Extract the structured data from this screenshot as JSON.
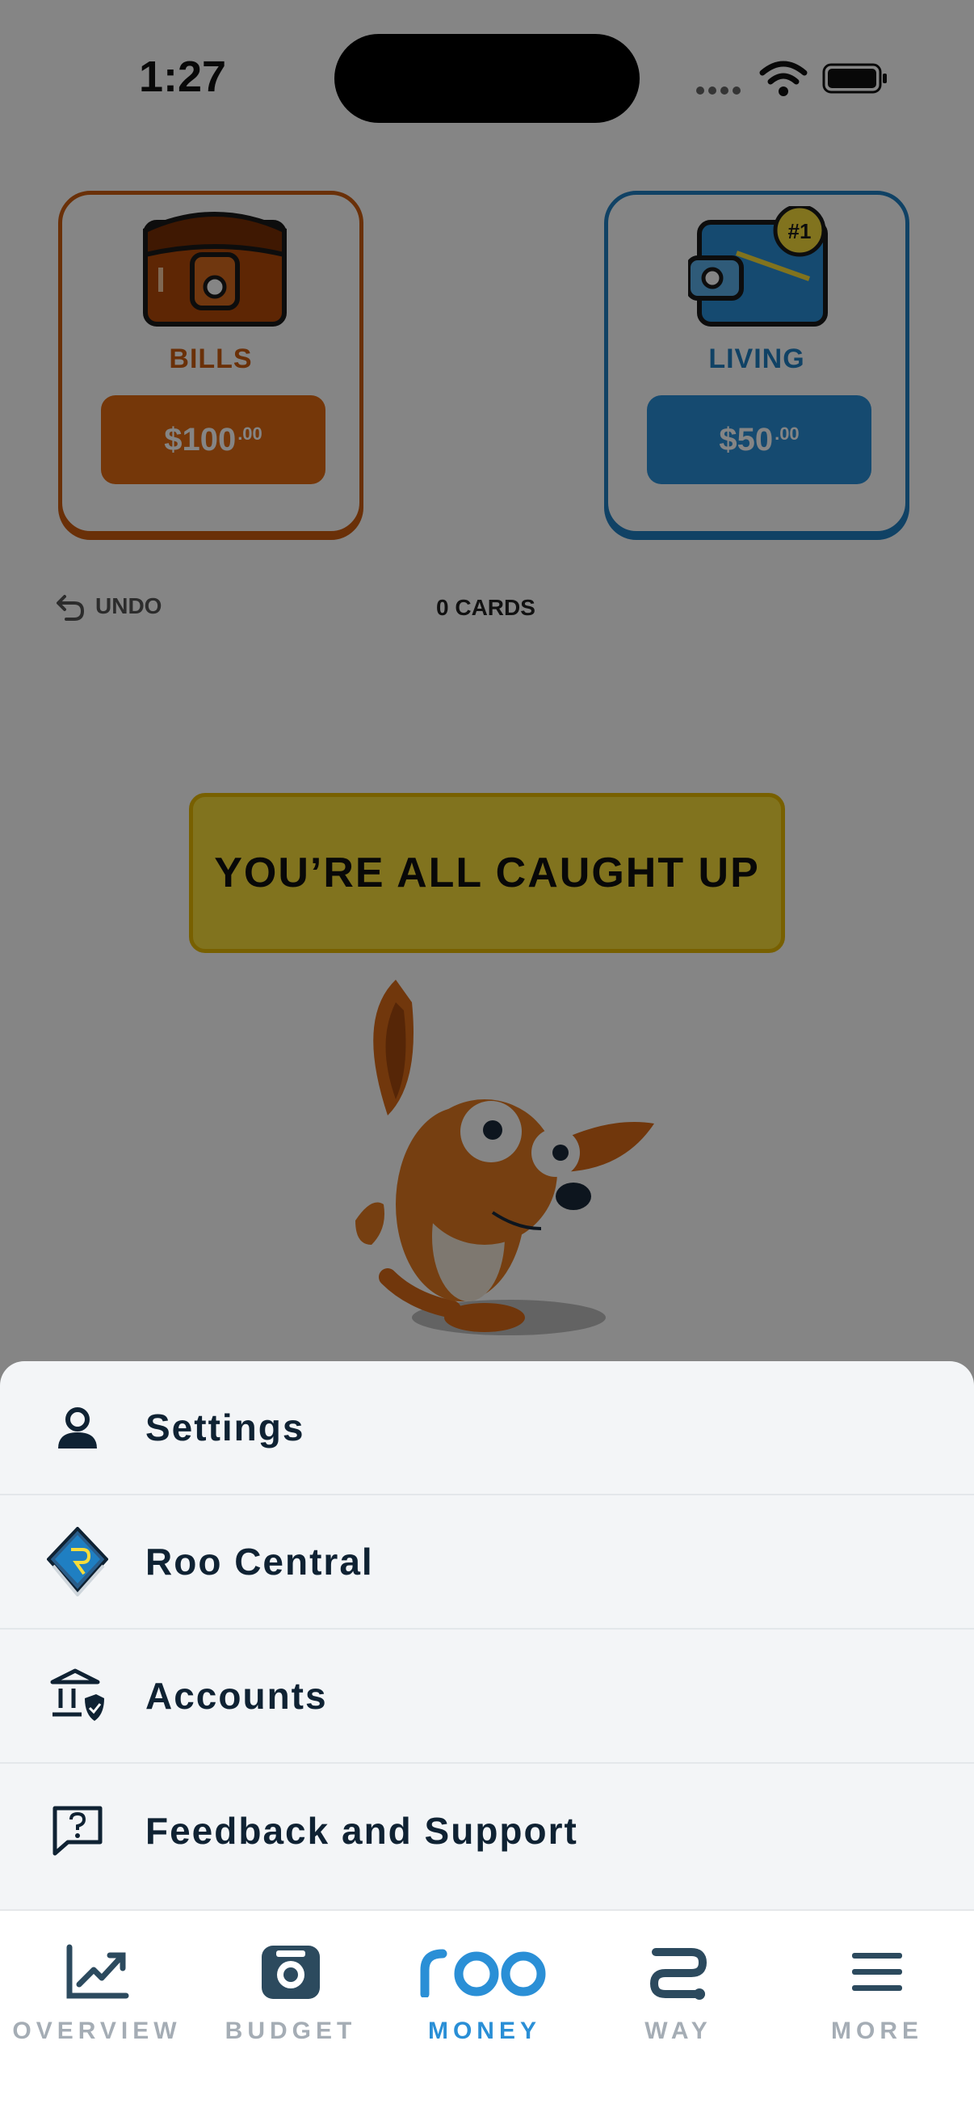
{
  "status_bar": {
    "time": "1:27"
  },
  "envelopes": [
    {
      "name": "BILLS",
      "amount": "$100",
      "cents": ".00",
      "color": "#e06a12",
      "icon": "bag-icon"
    },
    {
      "name": "LIVING",
      "amount": "$50",
      "cents": ".00",
      "color": "#2a8fd6",
      "icon": "wallet-icon",
      "badge": "#1"
    }
  ],
  "actions": {
    "undo_label": "UNDO",
    "cards_count": "0 CARDS"
  },
  "mascot": {
    "bubble_text": "YOU’RE ALL CAUGHT UP"
  },
  "menu": {
    "items": [
      {
        "label": "Settings",
        "icon": "user-icon"
      },
      {
        "label": "Roo Central",
        "icon": "roo-book-icon"
      },
      {
        "label": "Accounts",
        "icon": "bank-shield-icon"
      },
      {
        "label": "Feedback and Support",
        "icon": "question-chat-icon"
      }
    ]
  },
  "tabbar": {
    "tabs": [
      {
        "label": "OVERVIEW",
        "icon": "chart-up-icon",
        "active": false
      },
      {
        "label": "BUDGET",
        "icon": "camera-icon",
        "active": false
      },
      {
        "label": "MONEY",
        "icon": "roo-logo-icon",
        "active": true
      },
      {
        "label": "WAY",
        "icon": "route-icon",
        "active": false
      },
      {
        "label": "MORE",
        "icon": "menu-icon",
        "active": false
      }
    ]
  },
  "colors": {
    "accent": "#2a8fd6",
    "bills": "#e06a12",
    "bubble": "#f7dc3a",
    "text_dark": "#0f2233"
  }
}
